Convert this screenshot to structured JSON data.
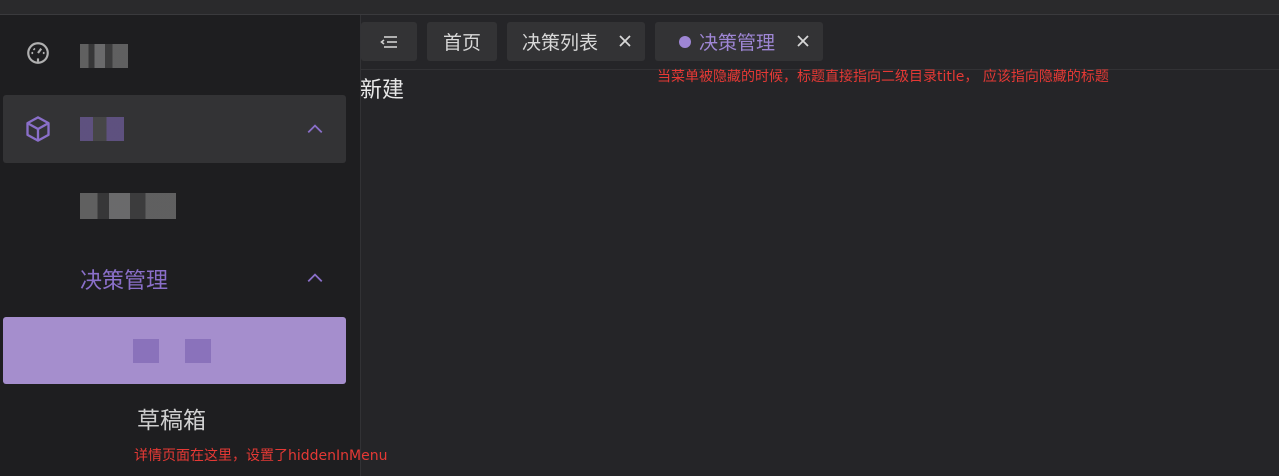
{
  "sidebar": {
    "items": [
      {
        "icon": "dashboard-icon",
        "label_redacted": true
      },
      {
        "icon": "cube-icon",
        "label_redacted": true,
        "expanded": true
      },
      {
        "label_redacted": true
      },
      {
        "label": "决策管理",
        "label_partially_redacted": true,
        "expanded": true
      },
      {
        "label_redacted": true,
        "active": true
      },
      {
        "label": "草稿箱"
      }
    ],
    "drafts_note": "详情页面在这里，设置了hiddenInMenu"
  },
  "tabs": {
    "home": "首页",
    "list": "决策列表",
    "manage": "决策管理"
  },
  "content": {
    "title": "新建",
    "annotation": "当菜单被隐藏的时候，标题直接指向二级目录title， 应该指向隐藏的标题"
  },
  "colors": {
    "accent": "#9e86d4",
    "active_bg": "#a58ecd",
    "annotation": "#e53935",
    "sidebar_bg": "#1e1e20",
    "main_bg": "#252528"
  }
}
